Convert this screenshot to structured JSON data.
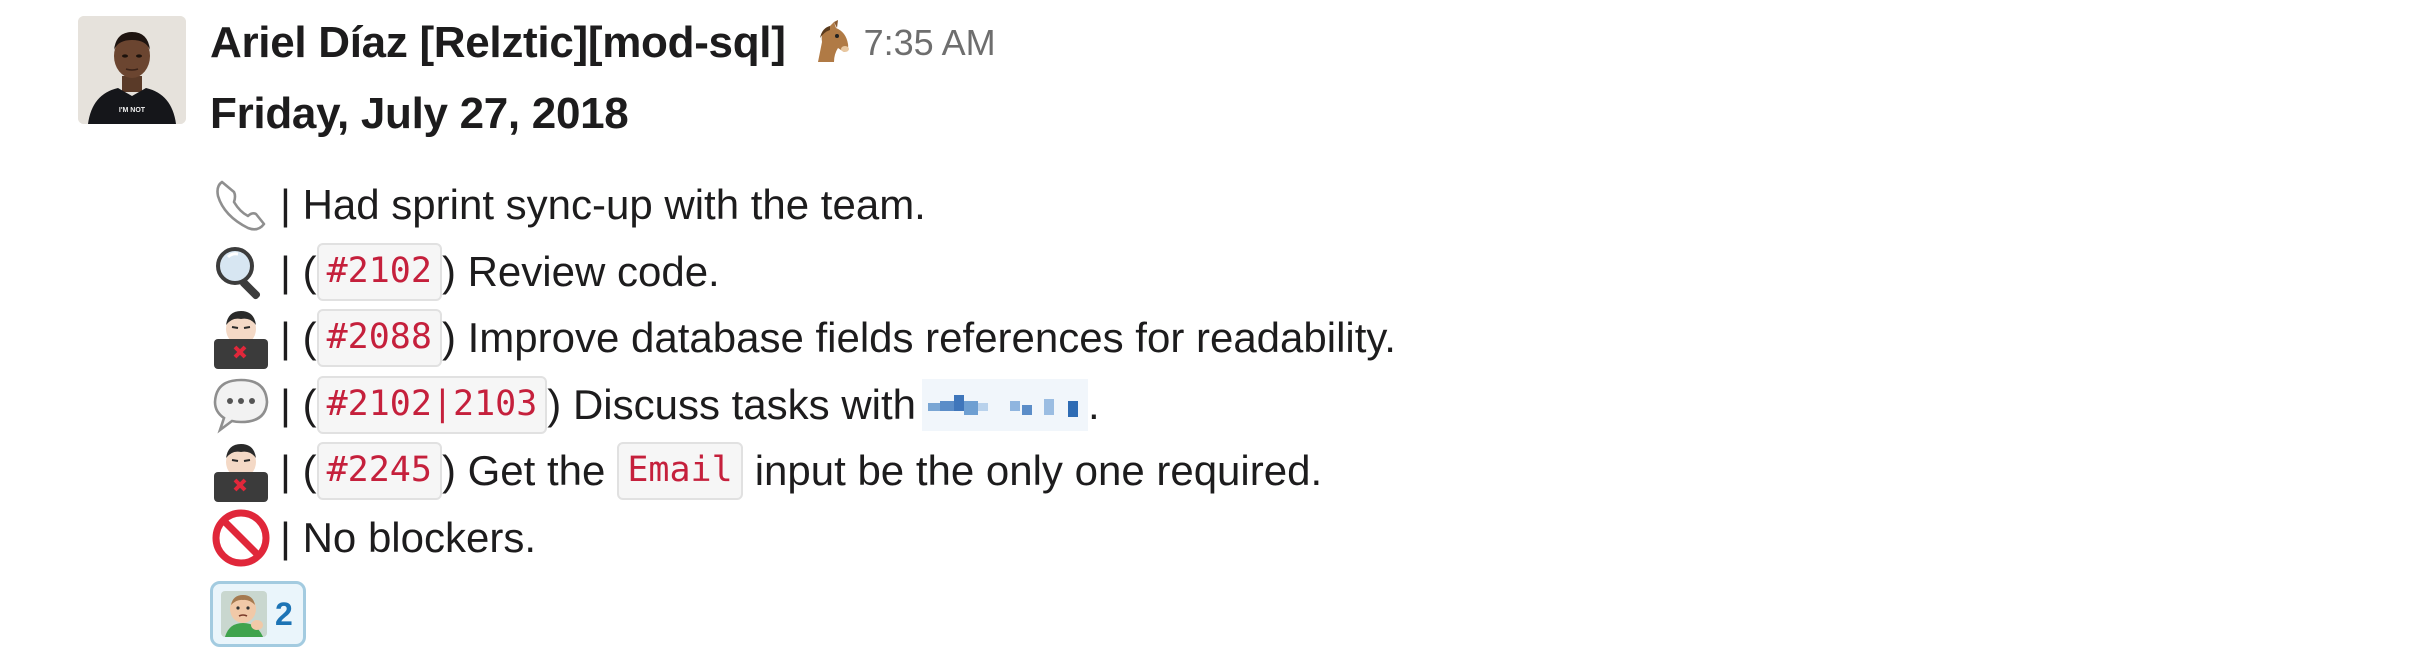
{
  "message": {
    "author": "Ariel Díaz [Relztic][mod-sql]",
    "status_emoji": "horse-face",
    "timestamp": "7:35 AM",
    "date_line": "Friday, July 27, 2018",
    "avatar_shirt_text": "I'M NOT",
    "lines": [
      {
        "icon": "phone-icon",
        "prefix": "| Had sprint sync-up with the team."
      },
      {
        "icon": "magnifying-glass-icon",
        "prefix": "| (",
        "code": "#2102",
        "suffix": ") Review code."
      },
      {
        "icon": "hacker-face-icon",
        "prefix": "| (",
        "code": "#2088",
        "suffix": ") Improve database fields references for readability."
      },
      {
        "icon": "speech-bubble-icon",
        "prefix": "| (",
        "code": "#2102|2103",
        "suffix": ") Discuss tasks with",
        "end": "."
      },
      {
        "icon": "hacker-face-icon",
        "prefix": "| (",
        "code": "#2245",
        "middle": ") Get the",
        "code2": "Email",
        "suffix": "input be the only one required."
      },
      {
        "icon": "no-entry-icon",
        "prefix": "| No blockers."
      }
    ],
    "reaction": {
      "emoji": "success-kid",
      "count": "2"
    }
  },
  "colors": {
    "text": "#1d1c1d",
    "timestamp": "#6e6e6e",
    "code_text": "#c5203c",
    "code_bg": "#f6f6f6",
    "code_border": "#e1e1e1",
    "reaction_border": "#a3cbe0",
    "reaction_bg": "#eaf5fb",
    "reaction_count": "#1d74b5"
  }
}
